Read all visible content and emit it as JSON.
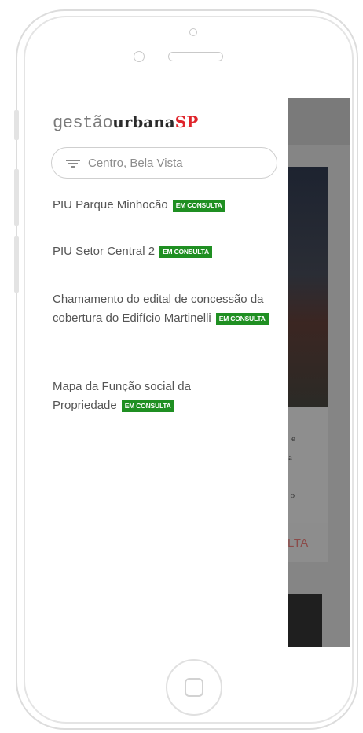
{
  "logo": {
    "part1": "gestão",
    "part2": "urbana",
    "part3": "SP"
  },
  "search": {
    "placeholder": "Centro, Bela Vista"
  },
  "items": [
    {
      "title": "PIU Parque Minhocão",
      "badge": "EM CONSULTA"
    },
    {
      "title": "PIU Setor Central 2",
      "badge": "EM CONSULTA"
    },
    {
      "title": "Chamamento do edital de concessão da cobertura do Edifício Martinelli",
      "badge": "EM CONSULTA"
    },
    {
      "title": "Mapa da Função social da Propriedade",
      "badge": "EM CONSULTA"
    }
  ],
  "background": {
    "button_label": "LTA",
    "text_fragments": [
      "e",
      "a",
      "a o"
    ]
  },
  "colors": {
    "badge": "#1f8f22",
    "logo_accent": "#e0242b"
  }
}
